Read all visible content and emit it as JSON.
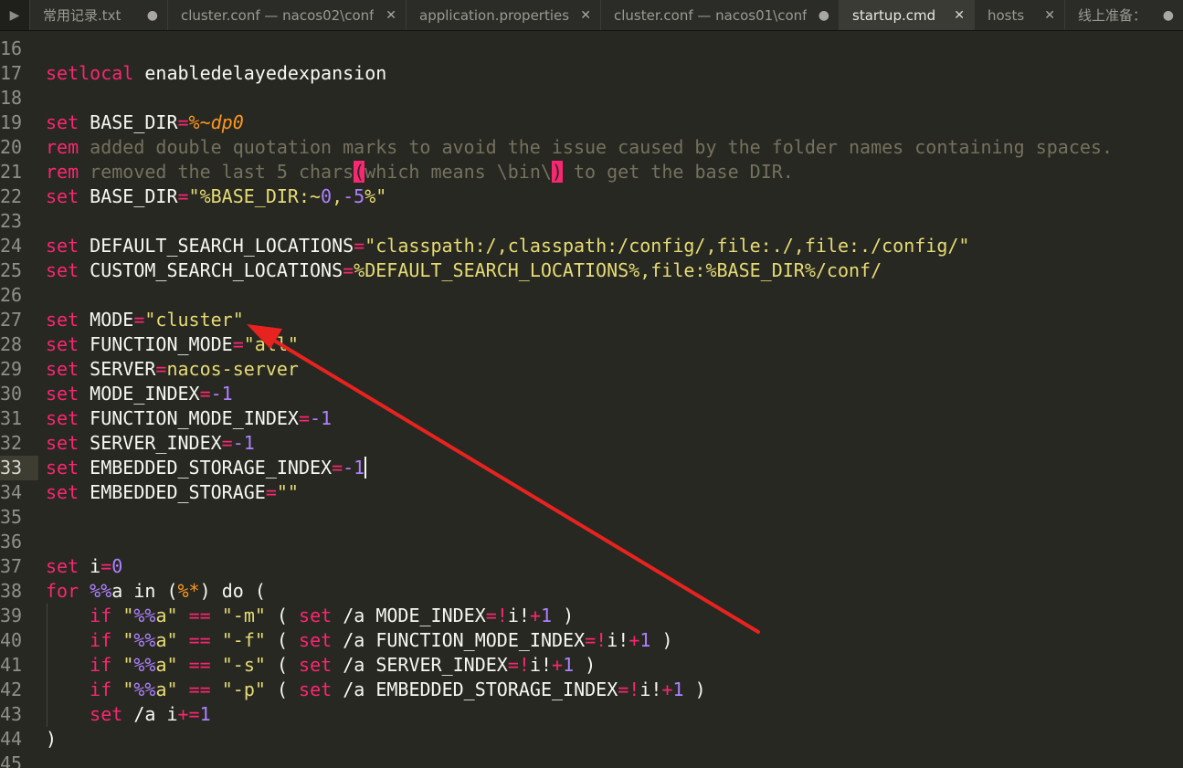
{
  "tabs": {
    "overflow_icon": "triangle-right",
    "items": [
      {
        "label": "常用记录.txt",
        "control": "●"
      },
      {
        "label": "cluster.conf — nacos02\\conf",
        "control": "✕"
      },
      {
        "label": "application.properties",
        "control": "✕"
      },
      {
        "label": "cluster.conf — nacos01\\conf",
        "control": "●"
      },
      {
        "label": "startup.cmd",
        "control": "✕"
      },
      {
        "label": "hosts",
        "control": "✕"
      },
      {
        "label": "线上准备：",
        "control": "●"
      }
    ]
  },
  "editor": {
    "line_numbers": [
      "16",
      "17",
      "18",
      "19",
      "20",
      "21",
      "22",
      "23",
      "24",
      "25",
      "26",
      "27",
      "28",
      "29",
      "30",
      "31",
      "32",
      "33",
      "34",
      "35",
      "36",
      "37",
      "38",
      "39",
      "40",
      "41",
      "42",
      "43",
      "44",
      "45"
    ],
    "code": {
      "l17_a": "setlocal",
      "l17_b": " enabledelayedexpansion",
      "l19_a": "set",
      "l19_b": " BASE_DIR",
      "l19_c": "=",
      "l19_d": "%~dp0",
      "l20_a": "rem",
      "l20_b": " added double quotation marks to avoid the issue caused by the folder names containing spaces.",
      "l21_a": "rem",
      "l21_b": " removed the last 5 chars",
      "l21_c": "(",
      "l21_d": "which means \\bin\\",
      "l21_e": ")",
      "l21_f": " to get the base DIR.",
      "l22_a": "set",
      "l22_b": " BASE_DIR",
      "l22_c": "=",
      "l22_d": "\"%BASE_DIR:~",
      "l22_e": "0",
      "l22_f": ",",
      "l22_g": "-5",
      "l22_h": "%\"",
      "l24_a": "set",
      "l24_b": " DEFAULT_SEARCH_LOCATIONS",
      "l24_c": "=",
      "l24_d": "\"classpath:/,classpath:/config/,file:./,file:./config/\"",
      "l25_a": "set",
      "l25_b": " CUSTOM_SEARCH_LOCATIONS",
      "l25_c": "=",
      "l25_d": "%DEFAULT_SEARCH_LOCATIONS%,file:%BASE_DIR%/conf/",
      "l27_a": "set",
      "l27_b": " MODE",
      "l27_c": "=",
      "l27_d": "\"cluster\"",
      "l28_a": "set",
      "l28_b": " FUNCTION_MODE",
      "l28_c": "=",
      "l28_d": "\"all\"",
      "l29_a": "set",
      "l29_b": " SERVER",
      "l29_c": "=",
      "l29_d": "nacos-server",
      "l30_a": "set",
      "l30_b": " MODE_INDEX",
      "l30_c": "=",
      "l30_d": "-1",
      "l31_a": "set",
      "l31_b": " FUNCTION_MODE_INDEX",
      "l31_c": "=",
      "l31_d": "-1",
      "l32_a": "set",
      "l32_b": " SERVER_INDEX",
      "l32_c": "=",
      "l32_d": "-1",
      "l33_a": "set",
      "l33_b": " EMBEDDED_STORAGE_INDEX",
      "l33_c": "=",
      "l33_d": "-1",
      "l34_a": "set",
      "l34_b": " EMBEDDED_STORAGE",
      "l34_c": "=",
      "l34_d": "\"\"",
      "l37_a": "set",
      "l37_b": " i",
      "l37_c": "=",
      "l37_d": "0",
      "l38_a": "for",
      "l38_b": " ",
      "l38_c": "%%",
      "l38_d": "a in (",
      "l38_e": "%*",
      "l38_f": ") do (",
      "l39_a": "if",
      "l39_b": "\"",
      "l39_c": "%%",
      "l39_d": "a\"",
      "l39_e": "==",
      "l39_f": "\"-m\"",
      "l39_g": "(",
      "l39_h": "set",
      "l39_i": "/a MODE_INDEX",
      "l39_j": "=",
      "l39_k": "!",
      "l39_l": "i!",
      "l39_m": "+",
      "l39_n": "1",
      "l39_o": ")",
      "l40_a": "if",
      "l40_b": "\"",
      "l40_c": "%%",
      "l40_d": "a\"",
      "l40_e": "==",
      "l40_f": "\"-f\"",
      "l40_g": "(",
      "l40_h": "set",
      "l40_i": "/a FUNCTION_MODE_INDEX",
      "l40_j": "=",
      "l40_k": "!",
      "l40_l": "i!",
      "l40_m": "+",
      "l40_n": "1",
      "l40_o": ")",
      "l41_a": "if",
      "l41_b": "\"",
      "l41_c": "%%",
      "l41_d": "a\"",
      "l41_e": "==",
      "l41_f": "\"-s\"",
      "l41_g": "(",
      "l41_h": "set",
      "l41_i": "/a SERVER_INDEX",
      "l41_j": "=",
      "l41_k": "!",
      "l41_l": "i!",
      "l41_m": "+",
      "l41_n": "1",
      "l41_o": ")",
      "l42_a": "if",
      "l42_b": "\"",
      "l42_c": "%%",
      "l42_d": "a\"",
      "l42_e": "==",
      "l42_f": "\"-p\"",
      "l42_g": "(",
      "l42_h": "set",
      "l42_i": "/a EMBEDDED_STORAGE_INDEX",
      "l42_j": "=",
      "l42_k": "!",
      "l42_l": "i!",
      "l42_m": "+",
      "l42_n": "1",
      "l42_o": ")",
      "l43_a": "set",
      "l43_b": " /a i",
      "l43_c": "+=",
      "l43_d": "1",
      "l44_a": ")"
    }
  },
  "colors": {
    "background": "#272822",
    "keyword": "#f92672",
    "number": "#ae81ff",
    "string": "#e6db74",
    "variable": "#fd971f",
    "comment": "#75715e",
    "annotation_arrow": "#e8231f"
  }
}
